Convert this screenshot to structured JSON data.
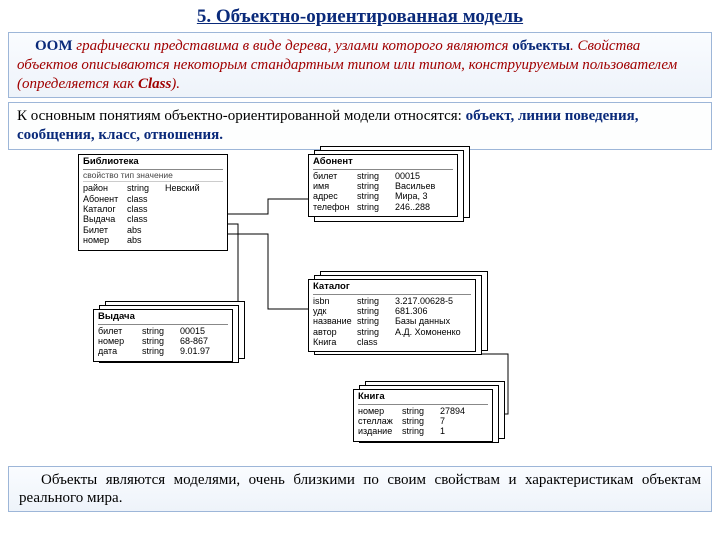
{
  "title": "5. Объектно-ориентированная модель",
  "intro": {
    "p1_pre": "ООМ",
    "p1_main": " графически представима в виде дерева, узлами которого являются ",
    "p1_obj": "объекты",
    "p1_rest": ". Свойства объектов описываются некоторым стандартным типом или типом, конструируемым пользователем (определяется как ",
    "p1_class": "Class",
    "p1_end": ")."
  },
  "concepts": {
    "lead": "К основным понятиям объектно-ориентированной модели относятся: ",
    "list": "объект, линии поведения, сообщения, класс, отношения."
  },
  "lib": {
    "title": "Библиотека",
    "sub": "свойство  тип  значение",
    "rows": [
      {
        "c1": "район",
        "c2": "string",
        "c3": "Невский"
      },
      {
        "c1": "Абонент",
        "c2": "class",
        "c3": ""
      },
      {
        "c1": "Каталог",
        "c2": "class",
        "c3": ""
      },
      {
        "c1": "Выдача",
        "c2": "class",
        "c3": ""
      },
      {
        "c1": "Билет",
        "c2": "abs",
        "c3": ""
      },
      {
        "c1": "номер",
        "c2": "abs",
        "c3": ""
      }
    ]
  },
  "abonent": {
    "title": "Абонент",
    "rows": [
      {
        "c1": "билет",
        "c2": "string",
        "c3": "00015"
      },
      {
        "c1": "имя",
        "c2": "string",
        "c3": "Васильев"
      },
      {
        "c1": "адрес",
        "c2": "string",
        "c3": "Мира, 3"
      },
      {
        "c1": "телефон",
        "c2": "string",
        "c3": "246..288"
      }
    ]
  },
  "vydacha": {
    "title": "Выдача",
    "rows": [
      {
        "c1": "билет",
        "c2": "string",
        "c3": "00015"
      },
      {
        "c1": "номер",
        "c2": "string",
        "c3": "68-867"
      },
      {
        "c1": "дата",
        "c2": "string",
        "c3": "9.01.97"
      }
    ]
  },
  "katalog": {
    "title": "Каталог",
    "rows": [
      {
        "c1": "isbn",
        "c2": "string",
        "c3": "3.217.00628-5"
      },
      {
        "c1": "удк",
        "c2": "string",
        "c3": "681.306"
      },
      {
        "c1": "название",
        "c2": "string",
        "c3": "Базы данных"
      },
      {
        "c1": "автор",
        "c2": "string",
        "c3": "А.Д. Хомоненко"
      },
      {
        "c1": "Книга",
        "c2": "class",
        "c3": ""
      }
    ]
  },
  "kniga": {
    "title": "Книга",
    "rows": [
      {
        "c1": "номер",
        "c2": "string",
        "c3": "27894"
      },
      {
        "c1": "стеллаж",
        "c2": "string",
        "c3": "7"
      },
      {
        "c1": "издание",
        "c2": "string",
        "c3": "1"
      }
    ]
  },
  "footer": "Объекты являются моделями, очень близкими по своим свойствам и характеристикам объектам реального мира."
}
